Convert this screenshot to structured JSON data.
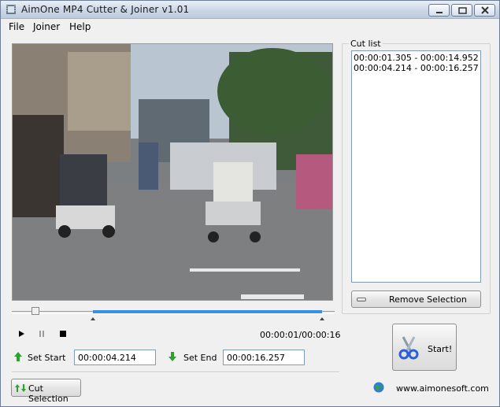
{
  "window": {
    "title": "AimOne MP4 Cutter & Joiner v1.01"
  },
  "menu": {
    "items": [
      "File",
      "Joiner",
      "Help"
    ]
  },
  "cut_list": {
    "legend": "Cut list",
    "items": [
      "00:00:01.305 - 00:00:14.952",
      "00:00:04.214 - 00:00:16.257"
    ],
    "remove_label": "Remove Selection"
  },
  "playback": {
    "time_readout": "00:00:01/00:00:16",
    "progress_fraction": 0.06,
    "selection_start_fraction": 0.25,
    "selection_end_fraction": 0.96
  },
  "selection": {
    "set_start_label": "Set Start",
    "start_value": "00:00:04.214",
    "set_end_label": "Set End",
    "end_value": "00:00:16.257",
    "cut_label": "Cut Selection"
  },
  "start_button": {
    "label": "Start!"
  },
  "footer": {
    "website": "www.aimonesoft.com"
  },
  "colors": {
    "accent_blue": "#3a8ee6",
    "arrow_green": "#2aa52a"
  },
  "icons": {
    "app": "film-strip-icon",
    "start": "scissors-icon",
    "site": "globe-icon"
  }
}
